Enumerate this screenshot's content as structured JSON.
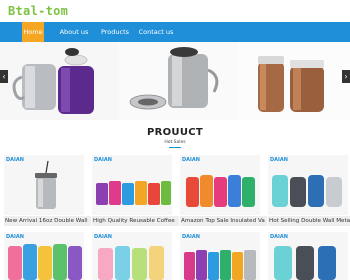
{
  "site": {
    "logo": "Btal-tom"
  },
  "nav": {
    "items": [
      {
        "label": "Home",
        "active": true
      },
      {
        "label": "About us",
        "active": false
      },
      {
        "label": "Products",
        "active": false
      },
      {
        "label": "Contact us",
        "active": false
      }
    ]
  },
  "hero": {
    "prev_icon": "‹",
    "next_icon": "›"
  },
  "products_section": {
    "title": "PROUUCT",
    "subtitle": "Hot Sales"
  },
  "products": [
    {
      "brand": "DAIAN",
      "title": "New Arrival 16oz Double Wall"
    },
    {
      "brand": "DAIAN",
      "title": "High Quality Reusable Coffee"
    },
    {
      "brand": "DAIAN",
      "title": "Amazon Top Sale Insulated Va"
    },
    {
      "brand": "DAIAN",
      "title": "Hot Selling Double Wall Metal"
    },
    {
      "brand": "DAIAN",
      "title": ""
    },
    {
      "brand": "DAIAN",
      "title": ""
    },
    {
      "brand": "DAIAN",
      "title": ""
    },
    {
      "brand": "DAIAN",
      "title": ""
    }
  ],
  "colors": {
    "nav_bg": "#1e8fd8",
    "nav_active": "#f5a623",
    "logo": "#7cc243"
  }
}
